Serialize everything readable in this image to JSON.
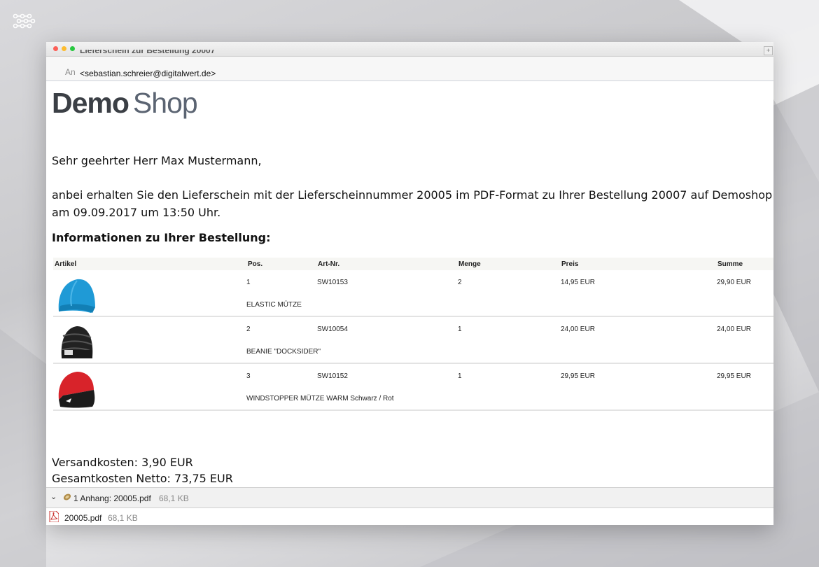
{
  "email": {
    "subject": "Lieferschein zur Bestellung 20007",
    "to_label": "An",
    "to_value": "<sebastian.schreier@digitalwert.de>"
  },
  "brand": {
    "part1": "Demo",
    "part2": "Shop"
  },
  "body": {
    "greeting": "Sehr geehrter Herr Max Mustermann,",
    "paragraph": "anbei erhalten Sie den Lieferschein mit der Lieferscheinnummer 20005 im PDF-Format zu Ihrer Bestellung 20007 auf Demoshop am 09.09.2017 um 13:50 Uhr.",
    "info_title": "Informationen zu Ihrer Bestellung:"
  },
  "table": {
    "headers": [
      "Artikel",
      "Pos.",
      "Art-Nr.",
      "Menge",
      "Preis",
      "Summe"
    ],
    "rows": [
      {
        "pos": "1",
        "artnr": "SW10153",
        "menge": "2",
        "preis": "14,95 EUR",
        "summe": "29,90 EUR",
        "name": "ELASTIC MÜTZE",
        "thumb": "blue-beanie-icon"
      },
      {
        "pos": "2",
        "artnr": "SW10054",
        "menge": "1",
        "preis": "24,00 EUR",
        "summe": "24,00 EUR",
        "name": "BEANIE \"DOCKSIDER\"",
        "thumb": "black-beanie-icon"
      },
      {
        "pos": "3",
        "artnr": "SW10152",
        "menge": "1",
        "preis": "29,95 EUR",
        "summe": "29,95 EUR",
        "name": "WINDSTOPPER MÜTZE WARM Schwarz / Rot",
        "thumb": "red-black-beanie-icon"
      }
    ]
  },
  "summary": {
    "shipping": "Versandkosten: 3,90 EUR",
    "total": "Gesamtkosten Netto: 73,75 EUR"
  },
  "attachments": {
    "bar_label": "1 Anhang: 20005.pdf",
    "bar_size": "68,1 KB",
    "file_name": "20005.pdf",
    "file_size": "68,1 KB"
  },
  "colors": {
    "accent_blue": "#1f9ad6",
    "beanie_red": "#d8232a"
  }
}
